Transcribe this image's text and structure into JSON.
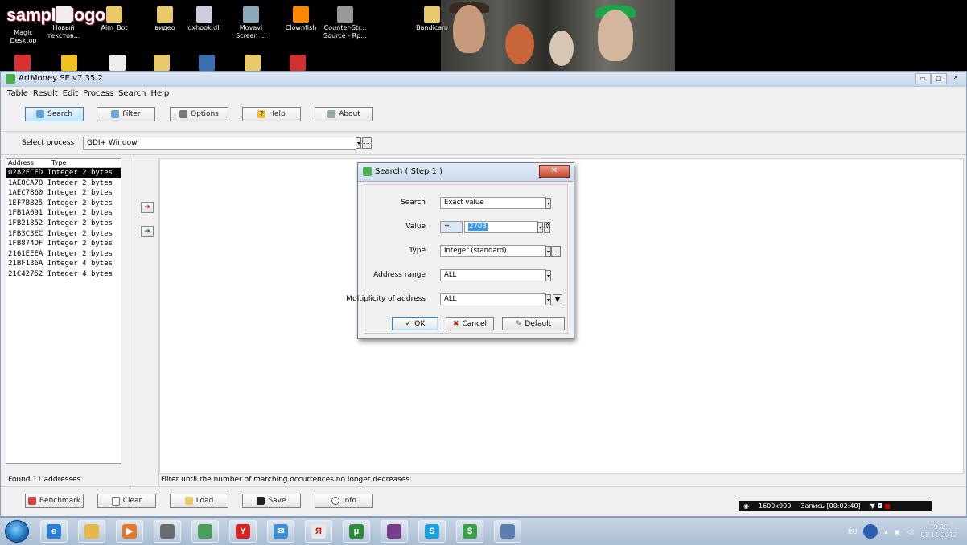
{
  "desktop": {
    "logo_text": "sample logo",
    "icons": [
      {
        "label": "Magic Desktop",
        "icon": "magic-desktop-icon",
        "color": "#d33"
      },
      {
        "label": "Новый текстов...",
        "icon": "text-file-icon",
        "color": "#eee"
      },
      {
        "label": "Aim_Bot",
        "icon": "folder-icon",
        "color": "#e9c96a"
      },
      {
        "label": "видео",
        "icon": "folder-icon",
        "color": "#e9c96a"
      },
      {
        "label": "dxhook.dll",
        "icon": "dll-file-icon",
        "color": "#ccd"
      },
      {
        "label": "Movavi Screen ...",
        "icon": "movavi-icon",
        "color": "#8ab"
      },
      {
        "label": "Clownfish",
        "icon": "clownfish-icon",
        "color": "#f80"
      },
      {
        "label": "Counter-Str... Source - Rp...",
        "icon": "counter-strike-icon",
        "color": "#999"
      },
      {
        "label": "Bandicam",
        "icon": "folder-icon",
        "color": "#e9c96a"
      }
    ],
    "second_row_icons": [
      "yandex-icon",
      "shortcut-icon",
      "text-file-icon",
      "folder-icon",
      "app-icon",
      "folder-icon",
      "acrobat-icon"
    ]
  },
  "window": {
    "title": "ArtMoney SE v7.35.2",
    "menu": [
      "Table",
      "Result",
      "Edit",
      "Process",
      "Search",
      "Help"
    ],
    "toolbar": [
      {
        "label": "Search",
        "icon": "search-icon",
        "active": true
      },
      {
        "label": "Filter",
        "icon": "filter-icon",
        "active": false
      },
      {
        "label": "Options",
        "icon": "options-icon",
        "active": false
      },
      {
        "label": "Help",
        "icon": "help-icon",
        "active": false
      },
      {
        "label": "About",
        "icon": "about-icon",
        "active": false
      }
    ],
    "process_label": "Select process",
    "process_value": "GDI+ Window",
    "list_headers": [
      "Address",
      "Type"
    ],
    "rows": [
      {
        "address": "0282FCED",
        "type": "Integer 2 bytes",
        "selected": true
      },
      {
        "address": "1AE8CA78",
        "type": "Integer 2 bytes",
        "selected": false
      },
      {
        "address": "1AEC7860",
        "type": "Integer 2 bytes",
        "selected": false
      },
      {
        "address": "1EF7B825",
        "type": "Integer 2 bytes",
        "selected": false
      },
      {
        "address": "1FB1A091",
        "type": "Integer 2 bytes",
        "selected": false
      },
      {
        "address": "1FB21852",
        "type": "Integer 2 bytes",
        "selected": false
      },
      {
        "address": "1FB3C3EC",
        "type": "Integer 2 bytes",
        "selected": false
      },
      {
        "address": "1FB874DF",
        "type": "Integer 2 bytes",
        "selected": false
      },
      {
        "address": "2161EEEA",
        "type": "Integer 2 bytes",
        "selected": false
      },
      {
        "address": "21BF136A",
        "type": "Integer 4 bytes",
        "selected": false
      },
      {
        "address": "21C42752",
        "type": "Integer 4 bytes",
        "selected": false
      }
    ],
    "status_left": "Found 11 addresses",
    "status_right": "Filter until the number of matching occurrences no longer decreases",
    "bottom_buttons": [
      {
        "label": "Benchmark",
        "icon": "benchmark-icon"
      },
      {
        "label": "Clear",
        "icon": "clear-icon"
      },
      {
        "label": "Load",
        "icon": "load-icon"
      },
      {
        "label": "Save",
        "icon": "save-icon"
      },
      {
        "label": "Info",
        "icon": "info-icon"
      }
    ],
    "recorder": {
      "resolution": "1600x900",
      "record_text": "Запись [00:02:40]"
    }
  },
  "dialog": {
    "title": "Search ( Step 1 )",
    "search_label": "Search",
    "search_value": "Exact value",
    "value_label": "Value",
    "value_operator": "=",
    "value_number": "2708",
    "type_label": "Type",
    "type_value": "Integer (standard)",
    "range_label": "Address range",
    "range_value": "ALL",
    "multiplicity_label": "Multiplicity of address",
    "multiplicity_value": "ALL",
    "ok_label": "OK",
    "cancel_label": "Cancel",
    "default_label": "Default"
  },
  "taskbar": {
    "items": [
      {
        "icon": "ie-icon",
        "color": "#2a7fd4",
        "glyph": "e"
      },
      {
        "icon": "explorer-icon",
        "color": "#e6b84a",
        "glyph": ""
      },
      {
        "icon": "media-player-icon",
        "color": "#e07a2a",
        "glyph": "▶"
      },
      {
        "icon": "tool-icon",
        "color": "#6b6b6b",
        "glyph": ""
      },
      {
        "icon": "app-icon",
        "color": "#4a9e5a",
        "glyph": ""
      },
      {
        "icon": "yandex-icon",
        "color": "#d92020",
        "glyph": "Y"
      },
      {
        "icon": "mail-icon",
        "color": "#3b8fd6",
        "glyph": "✉"
      },
      {
        "icon": "yandex-browser-icon",
        "color": "#e8e8e8",
        "glyph": "Я"
      },
      {
        "icon": "utorrent-icon",
        "color": "#2e8b3a",
        "glyph": "μ"
      },
      {
        "icon": "winrar-icon",
        "color": "#7a3c8c",
        "glyph": ""
      },
      {
        "icon": "skype-icon",
        "color": "#1a9fe0",
        "glyph": "S"
      },
      {
        "icon": "artmoney-icon",
        "color": "#3aa04a",
        "glyph": "$"
      },
      {
        "icon": "app-icon",
        "color": "#5a7fb0",
        "glyph": ""
      }
    ],
    "lang": "RU",
    "time": "19:19",
    "date": "01.11.2012"
  }
}
